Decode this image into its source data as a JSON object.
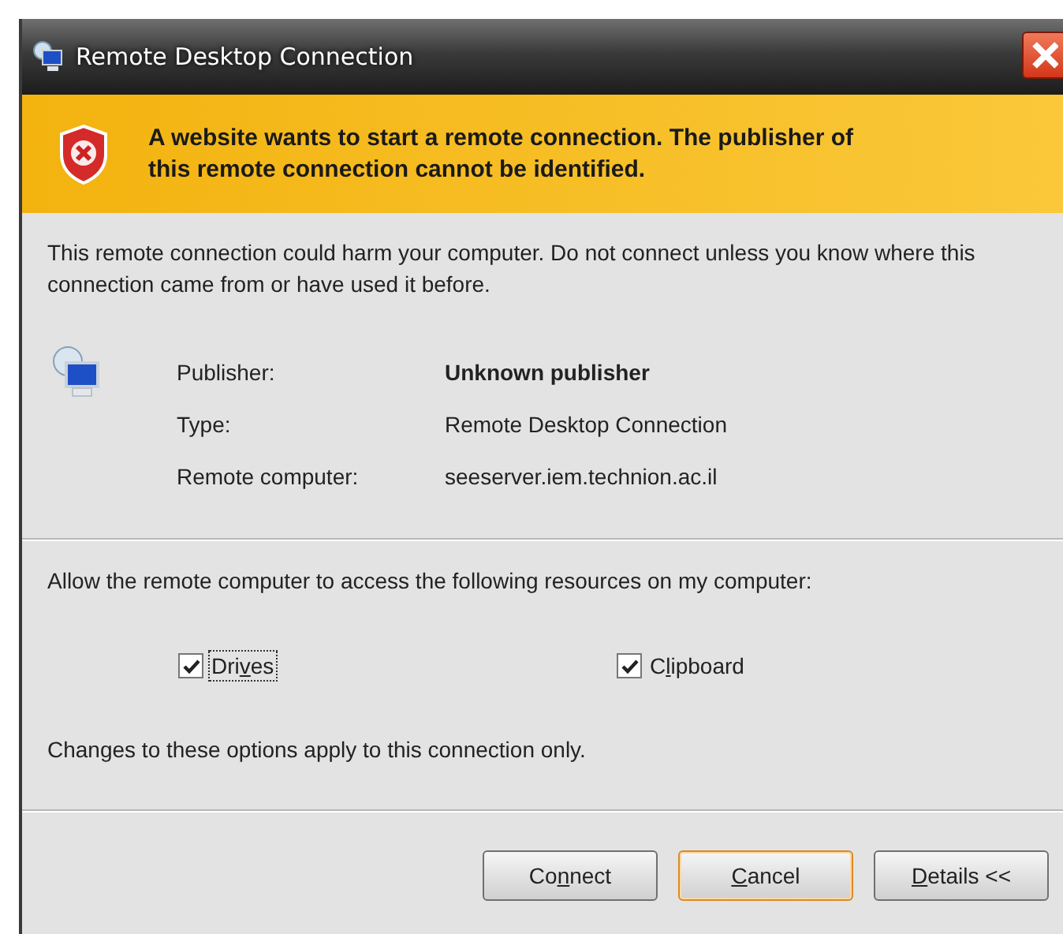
{
  "window": {
    "title": "Remote Desktop Connection"
  },
  "warning": {
    "text": "A website wants to start a remote connection. The publisher of this remote connection cannot be identified."
  },
  "intro": "This remote connection could harm your computer. Do not connect unless you know where this connection came from or have used it before.",
  "details": [
    {
      "label": "Publisher:",
      "value": "Unknown publisher",
      "emphasis": true
    },
    {
      "label": "Type:",
      "value": "Remote Desktop Connection",
      "emphasis": false
    },
    {
      "label": "Remote computer:",
      "value": "seeserver.iem.technion.ac.il",
      "emphasis": false
    }
  ],
  "resources": {
    "prompt": "Allow the remote computer to access the following resources on my computer:",
    "options": [
      {
        "label": {
          "before": "Dri",
          "key": "v",
          "after": "es"
        },
        "checked": true,
        "focused": true
      },
      {
        "label": {
          "before": "C",
          "key": "l",
          "after": "ipboard"
        },
        "checked": true,
        "focused": false
      }
    ],
    "note": "Changes to these options apply to this connection only."
  },
  "buttons": [
    {
      "label": {
        "before": "Co",
        "key": "n",
        "after": "nect"
      },
      "default": false
    },
    {
      "label": {
        "key": "C",
        "after": "ancel"
      },
      "default": true
    },
    {
      "label": {
        "key": "D",
        "after": "etails <<"
      },
      "default": false
    }
  ]
}
